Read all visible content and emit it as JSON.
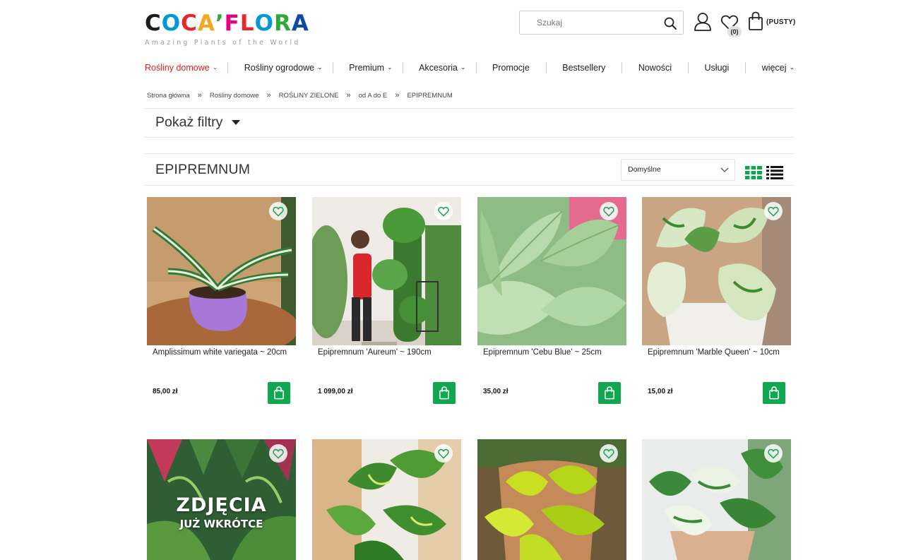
{
  "brand": {
    "logo_letters": [
      "C",
      "O",
      "C",
      "A",
      "’",
      "F",
      "L",
      "O",
      "R",
      "A"
    ],
    "logo_colors": [
      "#1d1d1d",
      "#0098d8",
      "#e8262b",
      "#f5a623",
      "#2baa3b",
      "#e5007e",
      "#e8262b",
      "#0098d8",
      "#2baa3b",
      "#0c4aa5"
    ],
    "tagline": "Amazing Plants of the World"
  },
  "header": {
    "search_placeholder": "Szukaj",
    "wishlist_count": "(0)",
    "cart_label": "(PUSTY)"
  },
  "nav": {
    "items": [
      {
        "label": "Rośliny domowe",
        "chevron": true,
        "active": true
      },
      {
        "label": "Rośliny ogrodowe",
        "chevron": true
      },
      {
        "label": "Premium",
        "chevron": true
      },
      {
        "label": "Akcesoria",
        "chevron": true
      },
      {
        "label": "Promocje"
      },
      {
        "label": "Bestsellery"
      },
      {
        "label": "Nowości"
      },
      {
        "label": "Usługi"
      },
      {
        "label": "więcej",
        "chevron": true
      }
    ],
    "chevron_glyph": "⌄"
  },
  "breadcrumb": {
    "items": [
      "Strona główna",
      "Rośliny domowe",
      "ROŚLINY ZIELONE",
      "od A do E",
      "EPIPREMNUM"
    ],
    "separator": "»"
  },
  "filters": {
    "label": "Pokaż filtry"
  },
  "category": {
    "title": "EPIPREMNUM",
    "sort_value": "Domyślne"
  },
  "colors": {
    "accent_green": "#0fa851",
    "nav_active": "#e02020"
  },
  "products": [
    {
      "name": "Amplissimum white variegata ~ 20cm",
      "price": "85,00 zł"
    },
    {
      "name": "Epipremnum 'Aureum' ~ 190cm",
      "price": "1 099,00 zł"
    },
    {
      "name": "Epipremnum 'Cebu Blue' ~ 25cm",
      "price": "35,00 zł"
    },
    {
      "name": "Epipremnum 'Marble Queen' ~ 10cm",
      "price": "15,00 zł"
    },
    {
      "name": "",
      "price": "",
      "soon_line1": "ZDJĘCIA",
      "soon_line2": "JUŻ WKRÓTCE"
    },
    {
      "name": "",
      "price": ""
    },
    {
      "name": "",
      "price": ""
    },
    {
      "name": "",
      "price": ""
    }
  ]
}
